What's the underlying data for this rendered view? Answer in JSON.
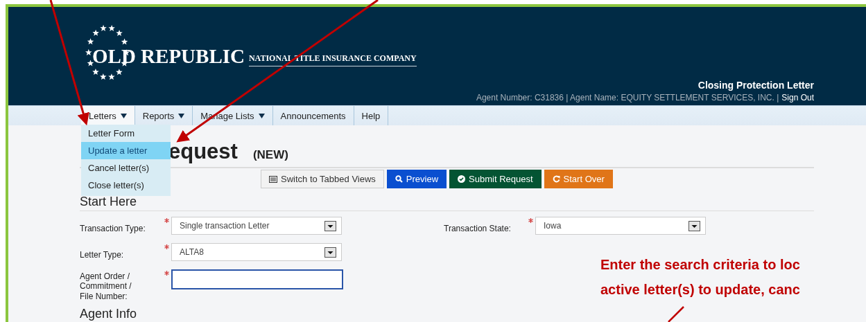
{
  "header": {
    "logo_name": "OLD REPUBLIC",
    "logo_tagline": "NATIONAL TITLE INSURANCE COMPANY",
    "app_title": "Closing Protection Letter",
    "agent_info": "Agent Number: C31836 | Agent Name: EQUITY SETTLEMENT SERVICES, INC. |",
    "sign_out": "Sign Out"
  },
  "nav": [
    {
      "label": "Letters",
      "has_menu": true,
      "selected": true
    },
    {
      "label": "Reports",
      "has_menu": true,
      "selected": false
    },
    {
      "label": "Manage Lists",
      "has_menu": true,
      "selected": false
    },
    {
      "label": "Announcements",
      "has_menu": false,
      "selected": false
    },
    {
      "label": "Help",
      "has_menu": false,
      "selected": false
    }
  ],
  "dropdown": [
    {
      "label": "Letter Form",
      "selected": false
    },
    {
      "label": "Update a letter",
      "selected": true
    },
    {
      "label": "Cancel letter(s)",
      "selected": false
    },
    {
      "label": "Close letter(s)",
      "selected": false
    }
  ],
  "page_title": "equest",
  "page_badge": "(NEW)",
  "buttons": [
    {
      "label": "Switch to Tabbed Views",
      "kind": "default"
    },
    {
      "label": "Preview",
      "kind": "primary"
    },
    {
      "label": "Submit Request",
      "kind": "success"
    },
    {
      "label": "Start Over",
      "kind": "warning"
    }
  ],
  "section": "Start Here",
  "form_rows": [
    {
      "fields": [
        {
          "label": "Transaction Type:",
          "required": true,
          "kind": "select",
          "value": "Single transaction Letter"
        },
        {
          "label": "Transaction State:",
          "required": true,
          "kind": "select",
          "value": "Iowa"
        }
      ]
    },
    {
      "fields": [
        {
          "label": "Letter Type:",
          "required": true,
          "kind": "select",
          "value": "ALTA8"
        }
      ]
    },
    {
      "fields": [
        {
          "label": "Agent Order / Commitment / File Number:",
          "required": true,
          "kind": "text"
        }
      ]
    }
  ],
  "next_section": "Agent Info",
  "annotation": [
    "Enter the search criteria to loc",
    "active letter(s) to update, canc"
  ]
}
